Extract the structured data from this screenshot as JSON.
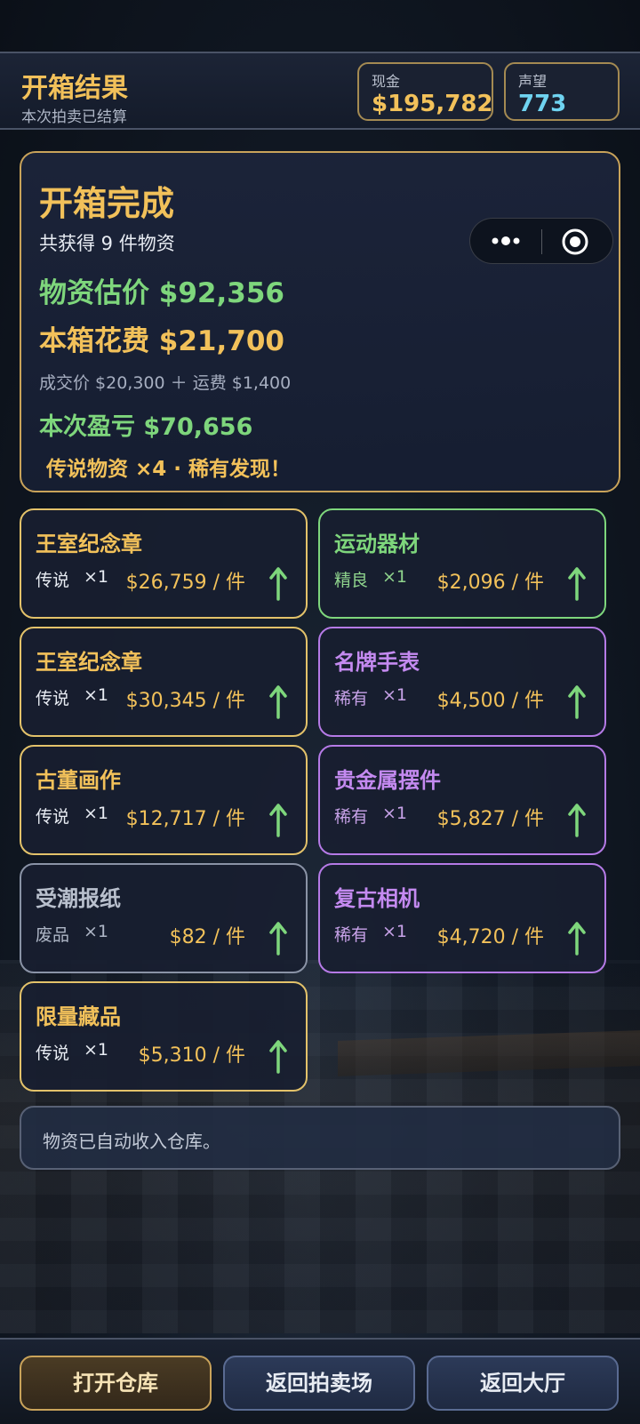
{
  "header": {
    "title": "开箱结果",
    "subtitle": "本次拍卖已结算",
    "cash_label": "现金",
    "cash_value": "$195,782",
    "reputation_label": "声望",
    "reputation_value": "773"
  },
  "summary": {
    "title": "开箱完成",
    "item_count": "共获得 9 件物资",
    "estimate": "物资估价 $92,356",
    "cost": "本箱花费 $21,700",
    "cost_detail": "成交价 $20,300 ＋ 运费 $1,400",
    "profit": "本次盈亏 $70,656",
    "highlight": "传说物资 ×4 · 稀有发现！"
  },
  "items": [
    {
      "name": "王室纪念章",
      "rarity": "传说",
      "qty": "×1",
      "price": "$26,759 / 件",
      "trend": "up"
    },
    {
      "name": "运动器材",
      "rarity": "精良",
      "qty": "×1",
      "price": "$2,096 / 件",
      "trend": "up"
    },
    {
      "name": "王室纪念章",
      "rarity": "传说",
      "qty": "×1",
      "price": "$30,345 / 件",
      "trend": "up"
    },
    {
      "name": "名牌手表",
      "rarity": "稀有",
      "qty": "×1",
      "price": "$4,500 / 件",
      "trend": "up"
    },
    {
      "name": "古董画作",
      "rarity": "传说",
      "qty": "×1",
      "price": "$12,717 / 件",
      "trend": "up"
    },
    {
      "name": "贵金属摆件",
      "rarity": "稀有",
      "qty": "×1",
      "price": "$5,827 / 件",
      "trend": "up"
    },
    {
      "name": "受潮报纸",
      "rarity": "废品",
      "qty": "×1",
      "price": "$82 / 件",
      "trend": "up"
    },
    {
      "name": "复古相机",
      "rarity": "稀有",
      "qty": "×1",
      "price": "$4,720 / 件",
      "trend": "up"
    },
    {
      "name": "限量藏品",
      "rarity": "传说",
      "qty": "×1",
      "price": "$5,310 / 件",
      "trend": "up"
    }
  ],
  "note": "物资已自动收入仓库。",
  "buttons": {
    "open_warehouse": "打开仓库",
    "back_auction": "返回拍卖场",
    "back_lobby": "返回大厅"
  },
  "colors": {
    "gold": "#f2c15a",
    "green": "#7ed67c",
    "purple": "#c48af0",
    "gray": "#b9c0cd",
    "cyan": "#6fd3f0"
  },
  "icons": {
    "capsule_menu": "more-dots-icon",
    "capsule_close": "target-circle-icon",
    "trend": "arrow-up-icon"
  }
}
